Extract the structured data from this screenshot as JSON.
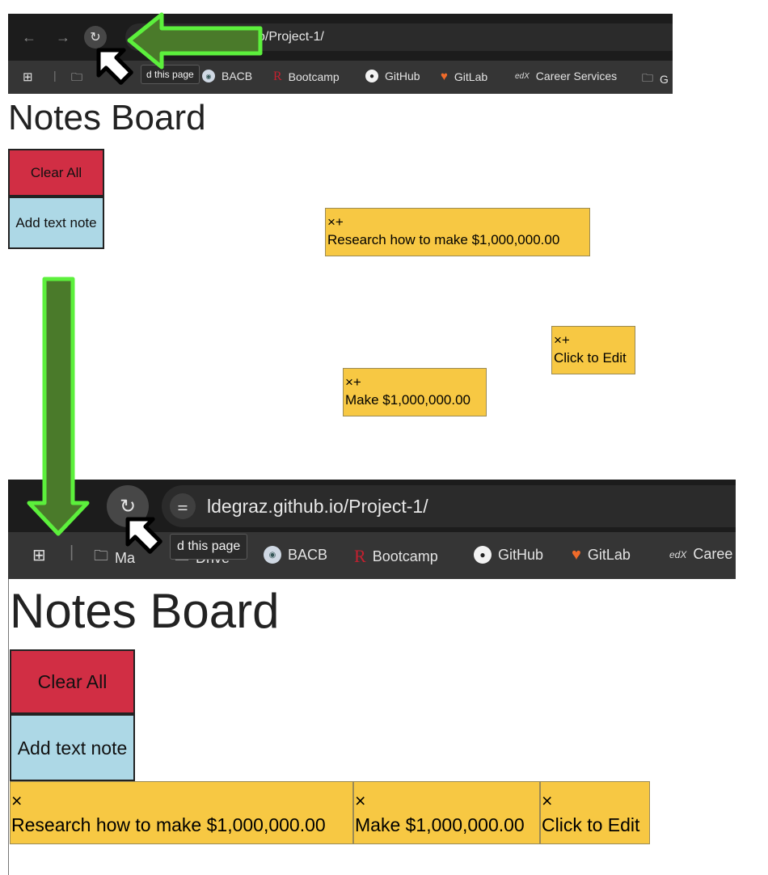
{
  "top": {
    "url_text": "o/Project-1/",
    "tooltip": "d this page",
    "bookmarks": [
      {
        "icon": "bacb-logo-icon",
        "label": "BACB"
      },
      {
        "icon": "bootcamp-r-icon",
        "label": "Bootcamp"
      },
      {
        "icon": "github-icon",
        "label": "GitHub"
      },
      {
        "icon": "gitlab-icon",
        "label": "GitLab"
      },
      {
        "icon": "edx-logo-icon",
        "label": "Career Services"
      },
      {
        "icon": "folder-icon",
        "label": "G"
      }
    ],
    "board": {
      "title": "Notes Board",
      "clear_label": "Clear All",
      "add_label": "Add text note",
      "notes": [
        {
          "controls": "×+",
          "text": "Research how to make $1,000,000.00"
        },
        {
          "controls": "×+",
          "text": "Click to Edit"
        },
        {
          "controls": "×+",
          "text": "Make $1,000,000.00"
        }
      ]
    }
  },
  "bottom": {
    "url_text": "ldegraz.github.io/Project-1/",
    "tooltip": "d this page",
    "bookmarks": [
      {
        "icon": "folder-icon",
        "label": "Ma"
      },
      {
        "icon": "folder-icon",
        "label": "Drive"
      },
      {
        "icon": "bacb-logo-icon",
        "label": "BACB"
      },
      {
        "icon": "bootcamp-r-icon",
        "label": "Bootcamp"
      },
      {
        "icon": "github-icon",
        "label": "GitHub"
      },
      {
        "icon": "gitlab-icon",
        "label": "GitLab"
      },
      {
        "icon": "edx-logo-icon",
        "label": "Caree"
      }
    ],
    "board": {
      "title": "Notes Board",
      "clear_label": "Clear All",
      "add_label": "Add text note",
      "notes": [
        {
          "controls": "×",
          "text": "Research how to make $1,000,000.00"
        },
        {
          "controls": "×",
          "text": "Make $1,000,000.00"
        },
        {
          "controls": "×",
          "text": "Click to Edit"
        }
      ]
    }
  },
  "colors": {
    "clear_button": "#d12e44",
    "add_button": "#add8e6",
    "note": "#f7c843",
    "arrow_fill": "#4a7a2a",
    "arrow_stroke": "#5cf03c"
  }
}
